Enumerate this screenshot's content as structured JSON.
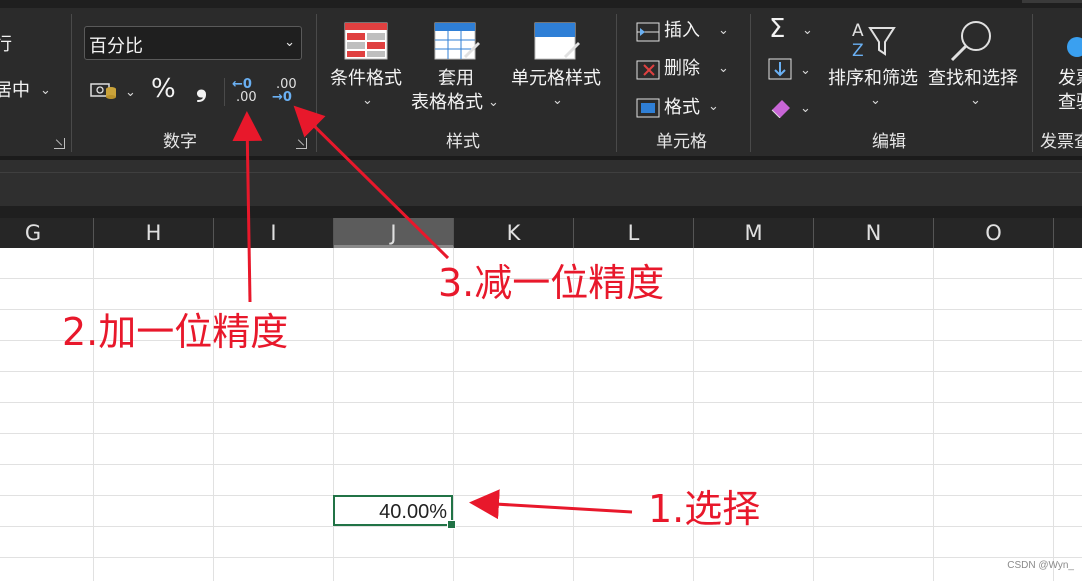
{
  "ribbon": {
    "left_partial_top": "行",
    "left_partial_mid": "居中",
    "number_format": "百分比",
    "percent_symbol": "%",
    "comma_symbol": "❟",
    "inc_decimal_top": "←0",
    "inc_decimal_bottom": ".00",
    "dec_decimal_top": ".00",
    "dec_decimal_bottom": "→0",
    "group_number": "数字",
    "cond_format": "条件格式",
    "table_format_line1": "套用",
    "table_format_line2": "表格格式",
    "cell_style": "单元格样式",
    "group_style": "样式",
    "insert": "插入",
    "delete": "删除",
    "format": "格式",
    "group_cells": "单元格",
    "sort_filter": "排序和筛选",
    "find_select": "查找和选择",
    "group_edit": "编辑",
    "invoice_line1": "发票",
    "invoice_line2": "查验",
    "group_invoice": "发票查"
  },
  "columns": [
    "G",
    "H",
    "I",
    "J",
    "K",
    "L",
    "M",
    "N",
    "O"
  ],
  "selected_column": "J",
  "cell": {
    "value": "40.00%"
  },
  "annotations": {
    "step1": "1.选择",
    "step2": "2.加一位精度",
    "step3": "3.减一位精度"
  },
  "watermark": "CSDN @Wyn_",
  "colors": {
    "annotation": "#e8182b",
    "selection": "#217346",
    "ribbon_bg": "#2b2b2b"
  }
}
